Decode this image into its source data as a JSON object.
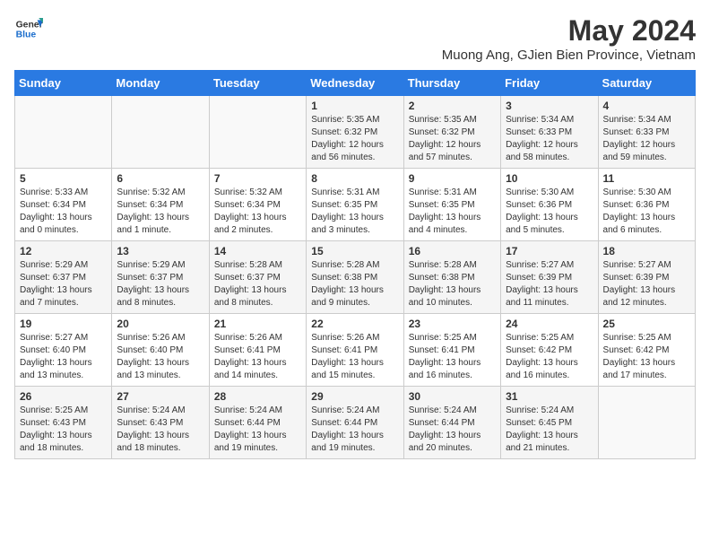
{
  "header": {
    "logo_general": "General",
    "logo_blue": "Blue",
    "title": "May 2024",
    "subtitle": "Muong Ang, GJien Bien Province, Vietnam"
  },
  "weekdays": [
    "Sunday",
    "Monday",
    "Tuesday",
    "Wednesday",
    "Thursday",
    "Friday",
    "Saturday"
  ],
  "weeks": [
    [
      {
        "day": "",
        "info": ""
      },
      {
        "day": "",
        "info": ""
      },
      {
        "day": "",
        "info": ""
      },
      {
        "day": "1",
        "info": "Sunrise: 5:35 AM\nSunset: 6:32 PM\nDaylight: 12 hours and 56 minutes."
      },
      {
        "day": "2",
        "info": "Sunrise: 5:35 AM\nSunset: 6:32 PM\nDaylight: 12 hours and 57 minutes."
      },
      {
        "day": "3",
        "info": "Sunrise: 5:34 AM\nSunset: 6:33 PM\nDaylight: 12 hours and 58 minutes."
      },
      {
        "day": "4",
        "info": "Sunrise: 5:34 AM\nSunset: 6:33 PM\nDaylight: 12 hours and 59 minutes."
      }
    ],
    [
      {
        "day": "5",
        "info": "Sunrise: 5:33 AM\nSunset: 6:34 PM\nDaylight: 13 hours and 0 minutes."
      },
      {
        "day": "6",
        "info": "Sunrise: 5:32 AM\nSunset: 6:34 PM\nDaylight: 13 hours and 1 minute."
      },
      {
        "day": "7",
        "info": "Sunrise: 5:32 AM\nSunset: 6:34 PM\nDaylight: 13 hours and 2 minutes."
      },
      {
        "day": "8",
        "info": "Sunrise: 5:31 AM\nSunset: 6:35 PM\nDaylight: 13 hours and 3 minutes."
      },
      {
        "day": "9",
        "info": "Sunrise: 5:31 AM\nSunset: 6:35 PM\nDaylight: 13 hours and 4 minutes."
      },
      {
        "day": "10",
        "info": "Sunrise: 5:30 AM\nSunset: 6:36 PM\nDaylight: 13 hours and 5 minutes."
      },
      {
        "day": "11",
        "info": "Sunrise: 5:30 AM\nSunset: 6:36 PM\nDaylight: 13 hours and 6 minutes."
      }
    ],
    [
      {
        "day": "12",
        "info": "Sunrise: 5:29 AM\nSunset: 6:37 PM\nDaylight: 13 hours and 7 minutes."
      },
      {
        "day": "13",
        "info": "Sunrise: 5:29 AM\nSunset: 6:37 PM\nDaylight: 13 hours and 8 minutes."
      },
      {
        "day": "14",
        "info": "Sunrise: 5:28 AM\nSunset: 6:37 PM\nDaylight: 13 hours and 8 minutes."
      },
      {
        "day": "15",
        "info": "Sunrise: 5:28 AM\nSunset: 6:38 PM\nDaylight: 13 hours and 9 minutes."
      },
      {
        "day": "16",
        "info": "Sunrise: 5:28 AM\nSunset: 6:38 PM\nDaylight: 13 hours and 10 minutes."
      },
      {
        "day": "17",
        "info": "Sunrise: 5:27 AM\nSunset: 6:39 PM\nDaylight: 13 hours and 11 minutes."
      },
      {
        "day": "18",
        "info": "Sunrise: 5:27 AM\nSunset: 6:39 PM\nDaylight: 13 hours and 12 minutes."
      }
    ],
    [
      {
        "day": "19",
        "info": "Sunrise: 5:27 AM\nSunset: 6:40 PM\nDaylight: 13 hours and 13 minutes."
      },
      {
        "day": "20",
        "info": "Sunrise: 5:26 AM\nSunset: 6:40 PM\nDaylight: 13 hours and 13 minutes."
      },
      {
        "day": "21",
        "info": "Sunrise: 5:26 AM\nSunset: 6:41 PM\nDaylight: 13 hours and 14 minutes."
      },
      {
        "day": "22",
        "info": "Sunrise: 5:26 AM\nSunset: 6:41 PM\nDaylight: 13 hours and 15 minutes."
      },
      {
        "day": "23",
        "info": "Sunrise: 5:25 AM\nSunset: 6:41 PM\nDaylight: 13 hours and 16 minutes."
      },
      {
        "day": "24",
        "info": "Sunrise: 5:25 AM\nSunset: 6:42 PM\nDaylight: 13 hours and 16 minutes."
      },
      {
        "day": "25",
        "info": "Sunrise: 5:25 AM\nSunset: 6:42 PM\nDaylight: 13 hours and 17 minutes."
      }
    ],
    [
      {
        "day": "26",
        "info": "Sunrise: 5:25 AM\nSunset: 6:43 PM\nDaylight: 13 hours and 18 minutes."
      },
      {
        "day": "27",
        "info": "Sunrise: 5:24 AM\nSunset: 6:43 PM\nDaylight: 13 hours and 18 minutes."
      },
      {
        "day": "28",
        "info": "Sunrise: 5:24 AM\nSunset: 6:44 PM\nDaylight: 13 hours and 19 minutes."
      },
      {
        "day": "29",
        "info": "Sunrise: 5:24 AM\nSunset: 6:44 PM\nDaylight: 13 hours and 19 minutes."
      },
      {
        "day": "30",
        "info": "Sunrise: 5:24 AM\nSunset: 6:44 PM\nDaylight: 13 hours and 20 minutes."
      },
      {
        "day": "31",
        "info": "Sunrise: 5:24 AM\nSunset: 6:45 PM\nDaylight: 13 hours and 21 minutes."
      },
      {
        "day": "",
        "info": ""
      }
    ]
  ]
}
